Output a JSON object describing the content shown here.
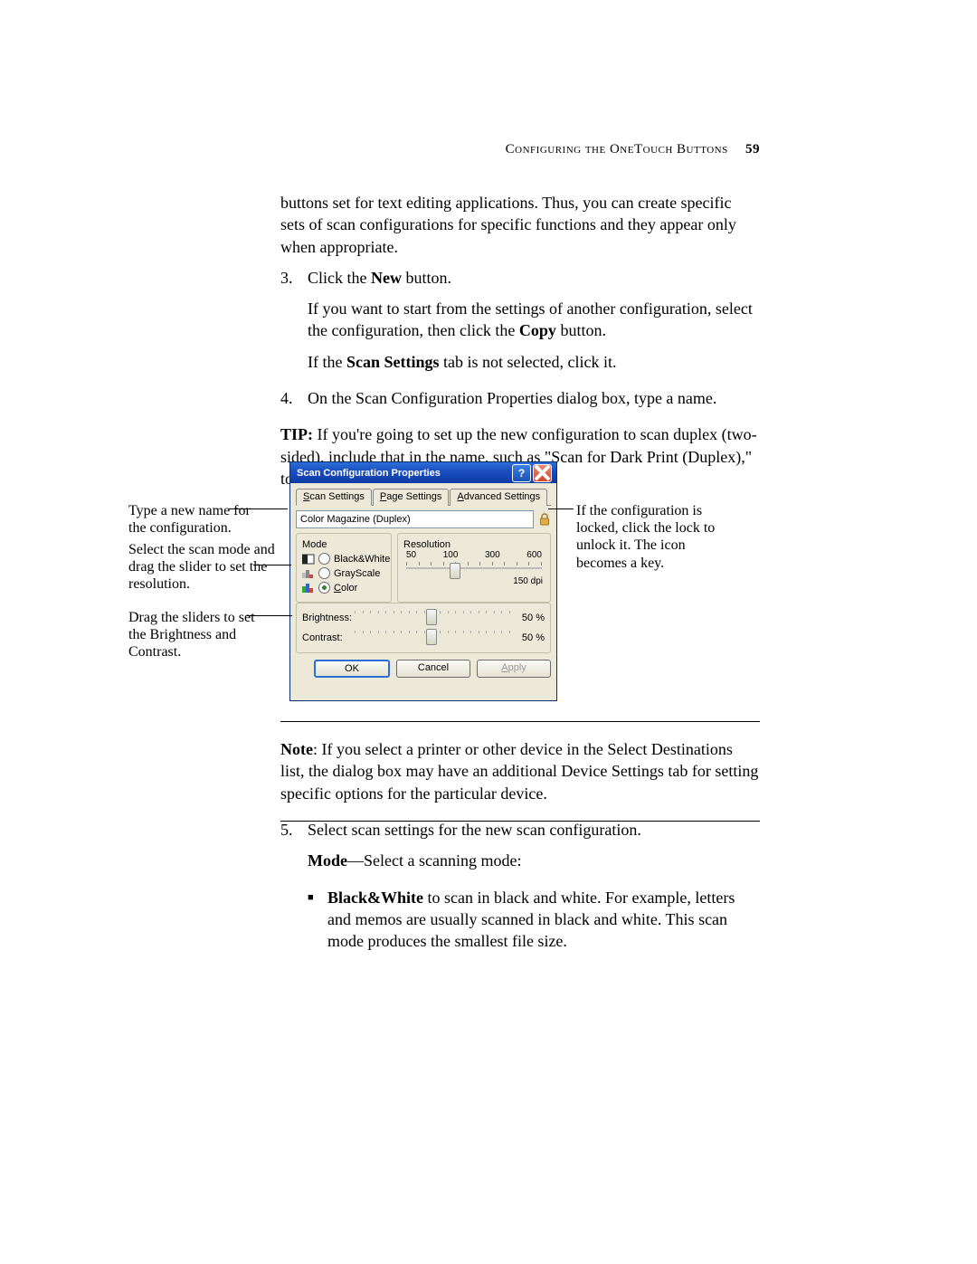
{
  "header": {
    "title": "Configuring the OneTouch Buttons",
    "page": "59"
  },
  "body": {
    "intro": "buttons set for text editing applications. Thus, you can create specific sets of scan configurations for specific functions and they appear only when appropriate.",
    "step3_num": "3.",
    "step3_l1_a": "Click the ",
    "step3_l1_b": "New",
    "step3_l1_c": " button.",
    "step3_l2_a": "If you want to start from the settings of another configuration, select the configuration, then click the ",
    "step3_l2_b": "Copy",
    "step3_l2_c": " button.",
    "step3_l3_a": "If the ",
    "step3_l3_b": "Scan Settings",
    "step3_l3_c": " tab is not selected, click it.",
    "step4_num": "4.",
    "step4_text": "On the Scan Configuration Properties dialog box, type a name.",
    "tip_label": "TIP:",
    "tip_text": " If you're going to set up the new configuration to scan duplex (two-sided), include that in the name, such as \"Scan for Dark Print (Duplex),\" to remind you that it is a duplex scan.",
    "note_label": "Note",
    "note_text": ":   If you select a printer or other device in the Select Destinations list, the dialog box may have an additional Device Settings tab for setting specific options for the particular device.",
    "step5_num": "5.",
    "step5_text": "Select scan settings for the new scan configuration.",
    "mode_label": "Mode",
    "mode_text": "—Select a scanning mode:",
    "bullet1_a": "Black&White",
    "bullet1_b": " to scan in black and white. For example, letters and memos are usually scanned in black and white. This scan mode produces the smallest file size."
  },
  "dialog": {
    "title": "Scan Configuration Properties",
    "tabs": {
      "scan": {
        "u": "S",
        "rest": "can Settings"
      },
      "page": {
        "u": "P",
        "rest": "age Settings"
      },
      "adv": {
        "u": "A",
        "rest": "dvanced Settings"
      }
    },
    "name_value": "Color Magazine (Duplex)",
    "mode_legend": "Mode",
    "res_legend": "Resolution",
    "mode_bw": "Black&White",
    "mode_gs": "GrayScale",
    "mode_color_u": "C",
    "mode_color_rest": "olor",
    "res_ticks": [
      "50",
      "100",
      "300",
      "600"
    ],
    "dpi": "150 dpi",
    "brightness_label": "Brightness:",
    "brightness_val": "50 %",
    "contrast_label": "Contrast:",
    "contrast_val": "50 %",
    "ok": "OK",
    "cancel": "Cancel",
    "apply_u": "A",
    "apply_rest": "pply"
  },
  "callouts": {
    "c1": "Type a new name for the configuration.",
    "c2": "Select the scan mode and drag the slider to set the resolution.",
    "c3": "Drag the sliders to set the Brightness and Contrast.",
    "c4": "If the configuration is locked, click the lock to unlock it. The icon becomes a key."
  }
}
